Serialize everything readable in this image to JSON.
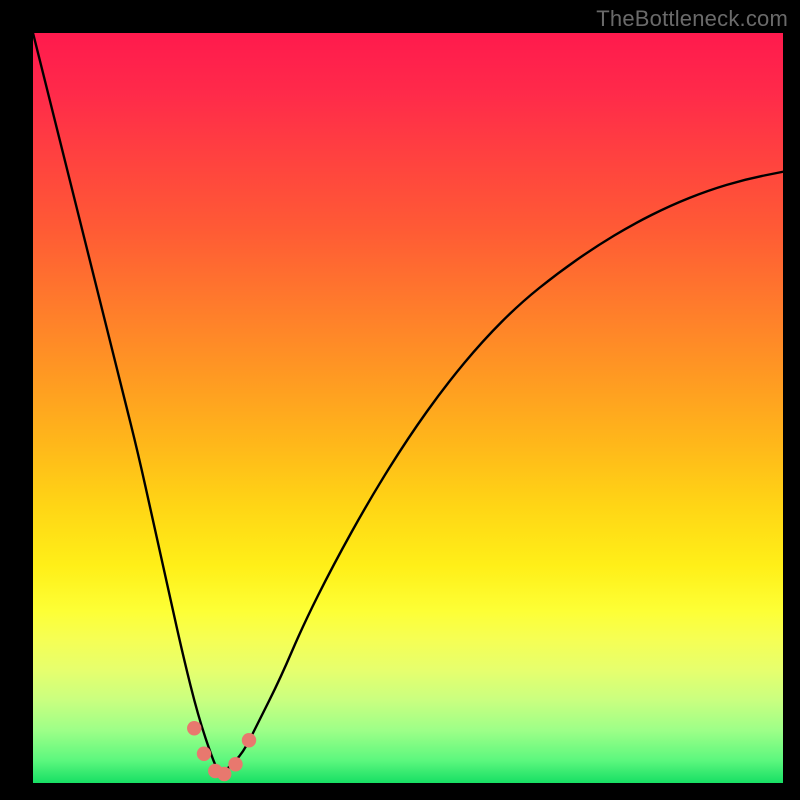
{
  "watermark": "TheBottleneck.com",
  "colors": {
    "frame": "#000000",
    "curve_stroke": "#000000",
    "marker_fill": "#e8786e",
    "marker_stroke": "#c95a52"
  },
  "chart_data": {
    "type": "line",
    "title": "",
    "xlabel": "",
    "ylabel": "",
    "xlim": [
      0,
      100
    ],
    "ylim": [
      0,
      100
    ],
    "grid": false,
    "legend": false,
    "comment": "V-shaped bottleneck curve; minimum near x≈25. Values are percent of axis range estimated from the image (0=bottom-left, 100=top-right).",
    "series": [
      {
        "name": "bottleneck-curve",
        "x": [
          0,
          2,
          4,
          6,
          8,
          10,
          12,
          14,
          16,
          18,
          20,
          22,
          24,
          25,
          26,
          28,
          30,
          33,
          36,
          40,
          45,
          50,
          55,
          60,
          65,
          70,
          75,
          80,
          85,
          90,
          95,
          100
        ],
        "y": [
          100,
          92,
          84,
          76,
          68,
          60,
          52,
          44,
          35,
          26,
          17,
          9,
          3,
          1,
          2,
          4,
          8,
          14,
          21,
          29,
          38,
          46,
          53,
          59,
          64,
          68,
          71.5,
          74.5,
          77,
          79,
          80.5,
          81.5
        ]
      }
    ],
    "markers": {
      "comment": "Salmon dots clustered at the curve minimum.",
      "points": [
        {
          "x": 21.5,
          "y": 7.3
        },
        {
          "x": 22.8,
          "y": 3.9
        },
        {
          "x": 24.3,
          "y": 1.6
        },
        {
          "x": 25.5,
          "y": 1.2
        },
        {
          "x": 27.0,
          "y": 2.5
        },
        {
          "x": 28.8,
          "y": 5.7
        }
      ]
    }
  }
}
